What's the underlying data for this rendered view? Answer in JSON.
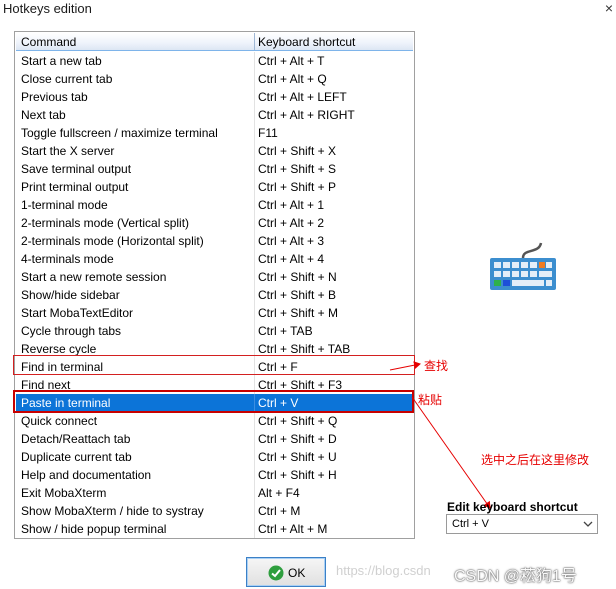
{
  "window": {
    "title": "Hotkeys edition",
    "close_label": "×"
  },
  "table": {
    "headers": [
      "Command",
      "Keyboard shortcut"
    ],
    "rows": [
      {
        "command": "Start a new tab",
        "shortcut": "Ctrl + Alt + T"
      },
      {
        "command": "Close current tab",
        "shortcut": "Ctrl + Alt + Q"
      },
      {
        "command": "Previous tab",
        "shortcut": "Ctrl + Alt + LEFT"
      },
      {
        "command": "Next tab",
        "shortcut": "Ctrl + Alt + RIGHT"
      },
      {
        "command": "Toggle fullscreen / maximize terminal",
        "shortcut": "F11"
      },
      {
        "command": "Start the X server",
        "shortcut": "Ctrl + Shift + X"
      },
      {
        "command": "Save terminal output",
        "shortcut": "Ctrl + Shift + S"
      },
      {
        "command": "Print terminal output",
        "shortcut": "Ctrl + Shift + P"
      },
      {
        "command": "1-terminal mode",
        "shortcut": "Ctrl + Alt + 1"
      },
      {
        "command": "2-terminals mode (Vertical split)",
        "shortcut": "Ctrl + Alt + 2"
      },
      {
        "command": "2-terminals mode (Horizontal split)",
        "shortcut": "Ctrl + Alt + 3"
      },
      {
        "command": "4-terminals mode",
        "shortcut": "Ctrl + Alt + 4"
      },
      {
        "command": "Start a new remote session",
        "shortcut": "Ctrl + Shift + N"
      },
      {
        "command": "Show/hide sidebar",
        "shortcut": "Ctrl + Shift + B"
      },
      {
        "command": "Start MobaTextEditor",
        "shortcut": "Ctrl + Shift + M"
      },
      {
        "command": "Cycle through tabs",
        "shortcut": "Ctrl + TAB"
      },
      {
        "command": "Reverse cycle",
        "shortcut": "Ctrl + Shift + TAB"
      },
      {
        "command": "Find in terminal",
        "shortcut": "Ctrl + F"
      },
      {
        "command": "Find next",
        "shortcut": "Ctrl + Shift + F3"
      },
      {
        "command": "Paste in terminal",
        "shortcut": "Ctrl + V"
      },
      {
        "command": "Quick connect",
        "shortcut": "Ctrl + Shift + Q"
      },
      {
        "command": "Detach/Reattach tab",
        "shortcut": "Ctrl + Shift + D"
      },
      {
        "command": "Duplicate current tab",
        "shortcut": "Ctrl + Shift + U"
      },
      {
        "command": "Help and documentation",
        "shortcut": "Ctrl + Shift + H"
      },
      {
        "command": "Exit MobaXterm",
        "shortcut": "Alt + F4"
      },
      {
        "command": "Show MobaXterm / hide to systray",
        "shortcut": "Ctrl + M"
      },
      {
        "command": "Show / hide popup terminal",
        "shortcut": "Ctrl + Alt + M"
      }
    ],
    "selected_index": 19,
    "highlighted_index": 17
  },
  "annotations": {
    "find": "查找",
    "paste": "粘贴",
    "edit_hint": "选中之后在这里修改",
    "color": "#e60000"
  },
  "edit_shortcut": {
    "label": "Edit keyboard shortcut",
    "value": "Ctrl + V"
  },
  "ok_button": {
    "label": "OK"
  },
  "watermark": {
    "faint": "https://blog.csdn",
    "text": "CSDN @菘狗1号"
  },
  "colors": {
    "selection": "#0c74d8",
    "header_border": "#7eb4ea",
    "ok_check": "#2e9e3e"
  },
  "icons": {
    "keyboard": "keyboard-icon",
    "check": "check-icon",
    "dropdown": "chevron-down-icon"
  }
}
